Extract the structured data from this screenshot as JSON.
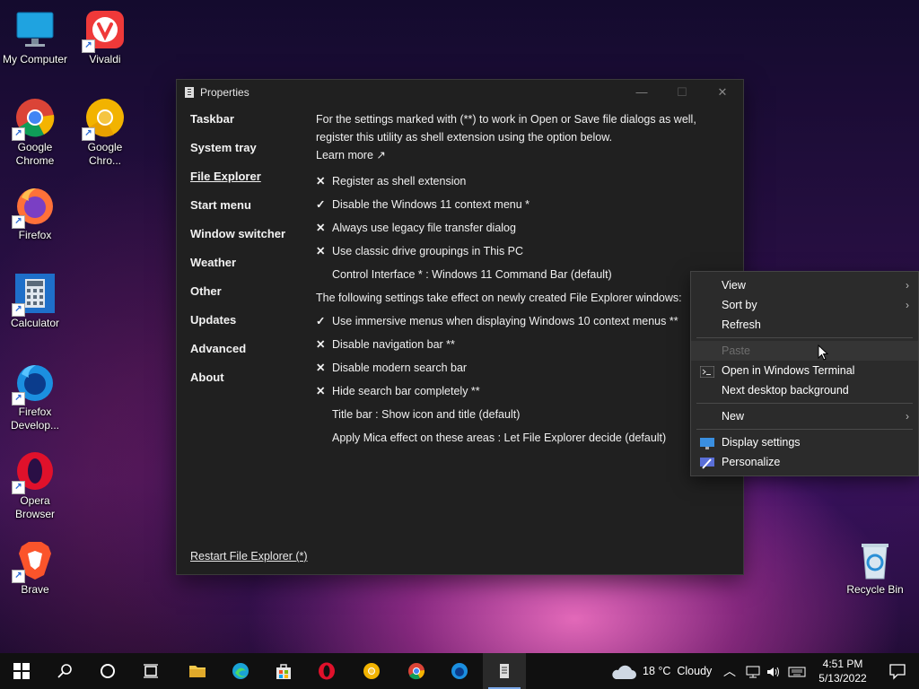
{
  "desktop": {
    "icons": [
      {
        "label": "My Computer",
        "icon": "monitor-icon"
      },
      {
        "label": "Vivaldi",
        "icon": "vivaldi-icon"
      },
      {
        "label": "Google Chrome",
        "icon": "chrome-icon"
      },
      {
        "label": "Google Chro...",
        "icon": "chrome-canary-icon"
      },
      {
        "label": "Firefox",
        "icon": "firefox-icon"
      },
      {
        "label": "Calculator",
        "icon": "calculator-icon"
      },
      {
        "label": "Firefox Develop...",
        "icon": "firefox-dev-icon"
      },
      {
        "label": "Opera Browser",
        "icon": "opera-icon"
      },
      {
        "label": "Brave",
        "icon": "brave-icon"
      },
      {
        "label": "Recycle Bin",
        "icon": "recycle-bin-icon"
      }
    ]
  },
  "window": {
    "title": "Properties",
    "nav": [
      "Taskbar",
      "System tray",
      "File Explorer",
      "Start menu",
      "Window switcher",
      "Weather",
      "Other",
      "Updates",
      "Advanced",
      "About"
    ],
    "active_nav": "File Explorer",
    "intro": "For the settings marked with (**) to work in Open or Save file dialogs as well, register this utility as shell extension using the option below.",
    "learn_more": "Learn more ↗",
    "options_a": [
      {
        "mark": "✕",
        "label": "Register as shell extension"
      },
      {
        "mark": "✓",
        "label": "Disable the Windows 11 context menu *"
      },
      {
        "mark": "✕",
        "label": "Always use legacy file transfer dialog"
      },
      {
        "mark": "✕",
        "label": "Use classic drive groupings in This PC"
      },
      {
        "mark": "",
        "label": "Control Interface * : Windows 11 Command Bar (default)"
      }
    ],
    "section_note": "The following settings take effect on newly created File Explorer windows:",
    "options_b": [
      {
        "mark": "✓",
        "label": "Use immersive menus when displaying Windows 10 context menus **"
      },
      {
        "mark": "✕",
        "label": "Disable navigation bar **"
      },
      {
        "mark": "✕",
        "label": "Disable modern search bar"
      },
      {
        "mark": "✕",
        "label": "Hide search bar completely **"
      },
      {
        "mark": "",
        "label": "Title bar : Show icon and title (default)"
      },
      {
        "mark": "",
        "label": "Apply Mica effect on these areas : Let File Explorer decide (default)"
      }
    ],
    "restart_link": "Restart File Explorer (*)"
  },
  "context_menu": {
    "items": [
      {
        "label": "View",
        "submenu": true
      },
      {
        "label": "Sort by",
        "submenu": true
      },
      {
        "label": "Refresh",
        "submenu": false
      },
      {
        "label": "Paste",
        "disabled": true
      },
      {
        "label": "Open in Windows Terminal",
        "icon": "terminal-icon"
      },
      {
        "label": "Next desktop background"
      },
      {
        "label": "New",
        "submenu": true
      },
      {
        "label": "Display settings",
        "icon": "display-icon"
      },
      {
        "label": "Personalize",
        "icon": "personalize-icon"
      }
    ]
  },
  "taskbar": {
    "weather_temp": "18 °C",
    "weather_desc": "Cloudy",
    "time": "4:51 PM",
    "date": "5/13/2022"
  }
}
